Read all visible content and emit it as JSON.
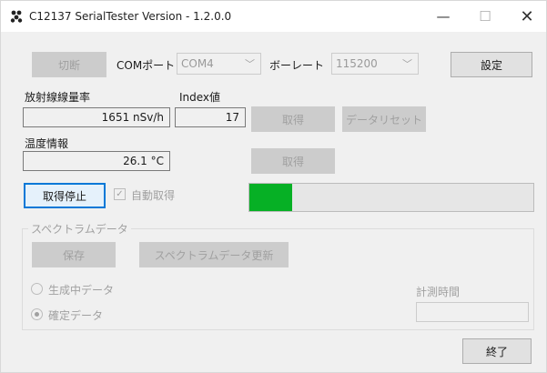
{
  "window": {
    "title": "C12137 SerialTester Version - 1.2.0.0",
    "minimize_glyph": "—",
    "maximize_glyph": "☐",
    "close_glyph": "✕"
  },
  "toolbar": {
    "disconnect_label": "切断",
    "com_port_label": "COMポート",
    "com_port_value": "COM4",
    "baud_rate_label": "ボーレート",
    "baud_rate_value": "115200",
    "settings_label": "設定"
  },
  "dose": {
    "dose_rate_label": "放射線線量率",
    "dose_rate_value": "1651 nSv/h",
    "index_label": "Index値",
    "index_value": "17",
    "acquire_label": "取得",
    "data_reset_label": "データリセット"
  },
  "temperature": {
    "label": "温度情報",
    "value": "26.1 °C",
    "acquire_label": "取得"
  },
  "acquisition": {
    "stop_label": "取得停止",
    "auto_acquire_label": "自動取得",
    "auto_acquire_checked": true,
    "progress_fraction": 0.15,
    "progress_color": "#06b025"
  },
  "spectrum": {
    "group_label": "スペクトラムデータ",
    "save_label": "保存",
    "update_label": "スペクトラムデータ更新",
    "radio_generating_label": "生成中データ",
    "radio_confirmed_label": "確定データ",
    "selected_radio": "confirmed",
    "measure_time_label": "計測時間",
    "measure_time_value": ""
  },
  "footer": {
    "exit_label": "終了"
  },
  "colors": {
    "focus_border": "#0078d7",
    "disabled_text": "#a0a0a0"
  }
}
